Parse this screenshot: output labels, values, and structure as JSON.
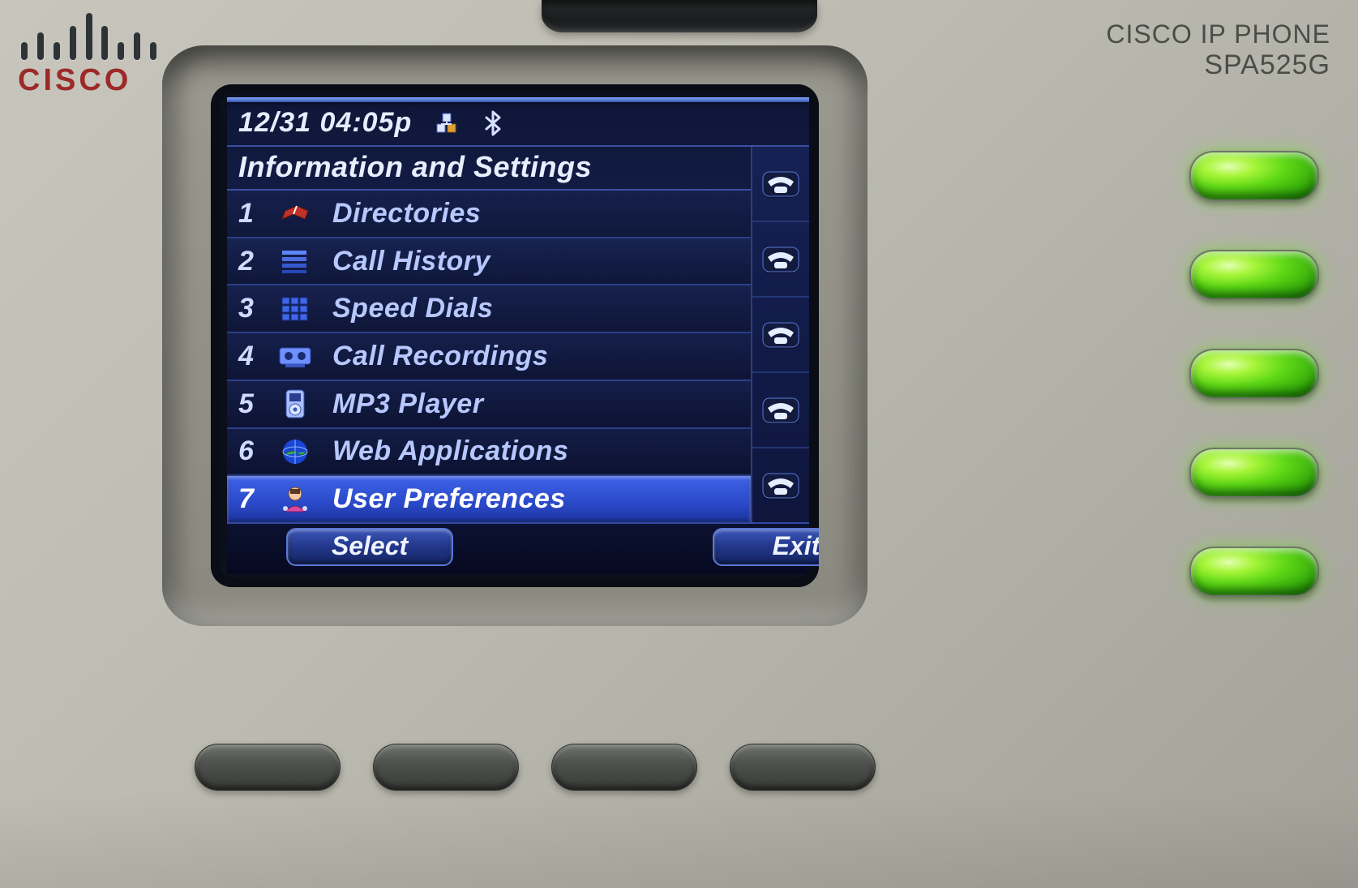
{
  "brand": {
    "word": "CISCO"
  },
  "model": {
    "line1": "CISCO IP PHONE",
    "line2": "SPA525G"
  },
  "lcd": {
    "status": {
      "datetime": "12/31 04:05p",
      "icons": {
        "network": "network-icon",
        "bluetooth": "bluetooth-icon"
      }
    },
    "title": "Information and Settings",
    "menu": [
      {
        "num": "1",
        "label": "Directories",
        "icon": "book-icon",
        "selected": false
      },
      {
        "num": "2",
        "label": "Call History",
        "icon": "list-icon",
        "selected": false
      },
      {
        "num": "3",
        "label": "Speed Dials",
        "icon": "grid-icon",
        "selected": false
      },
      {
        "num": "4",
        "label": "Call Recordings",
        "icon": "tape-icon",
        "selected": false
      },
      {
        "num": "5",
        "label": "MP3 Player",
        "icon": "mp3-icon",
        "selected": false
      },
      {
        "num": "6",
        "label": "Web Applications",
        "icon": "globe-icon",
        "selected": false
      },
      {
        "num": "7",
        "label": "User Preferences",
        "icon": "user-icon",
        "selected": true
      }
    ],
    "softkeys": {
      "left": "Select",
      "right": "Exit"
    },
    "linekeys_count": 5
  },
  "hardware": {
    "line_leds": 5,
    "softkey_buttons": 4
  }
}
